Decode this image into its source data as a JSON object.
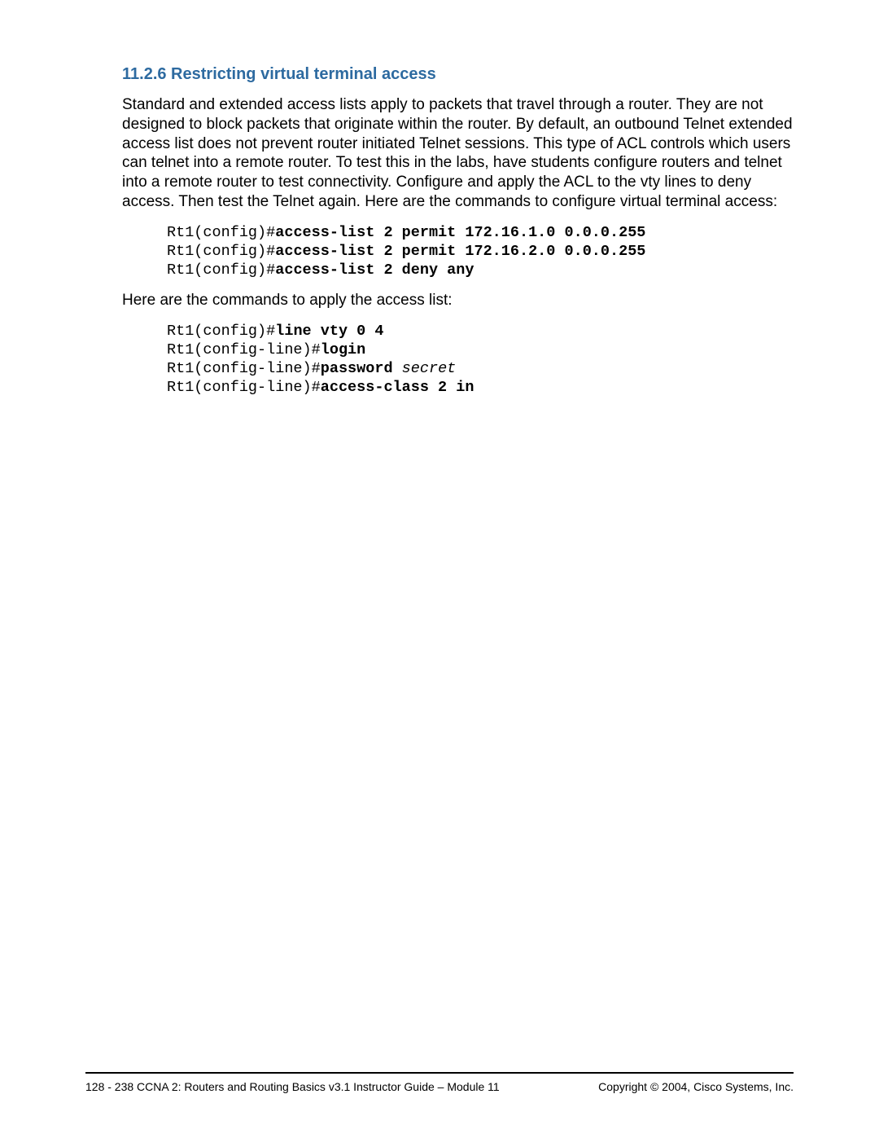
{
  "heading": "11.2.6 Restricting virtual terminal access",
  "para1": "Standard and extended access lists apply to packets that travel through a router. They are not designed to block packets that originate within the router. By default, an outbound Telnet extended access list does not prevent router initiated Telnet sessions. This type of ACL controls which users can telnet into a remote router. To test this in the labs, have students configure routers and telnet into a remote router to test connectivity. Configure and apply the ACL to the vty lines to deny access. Then test the Telnet again. Here are the commands to configure virtual terminal access:",
  "code1": {
    "l1p": "Rt1(config)#",
    "l1b": "access-list 2 permit 172.16.1.0 0.0.0.255",
    "l2p": "Rt1(config)#",
    "l2b": "access-list 2 permit 172.16.2.0 0.0.0.255",
    "l3p": "Rt1(config)#",
    "l3b": "access-list 2 deny any"
  },
  "para2": "Here are the commands to apply the access list:",
  "code2": {
    "l1p": "Rt1(config)#",
    "l1b": "line vty 0 4",
    "l2p": "Rt1(config-line)#",
    "l2b": "login",
    "l3p": "Rt1(config-line)#",
    "l3b": "password ",
    "l3i": "secret",
    "l4p": "Rt1(config-line)#",
    "l4b": "access-class 2 in"
  },
  "footer": {
    "left": "128 - 238    CCNA 2: Routers and Routing Basics v3.1 Instructor Guide – Module 11",
    "right": "Copyright © 2004, Cisco Systems, Inc."
  }
}
